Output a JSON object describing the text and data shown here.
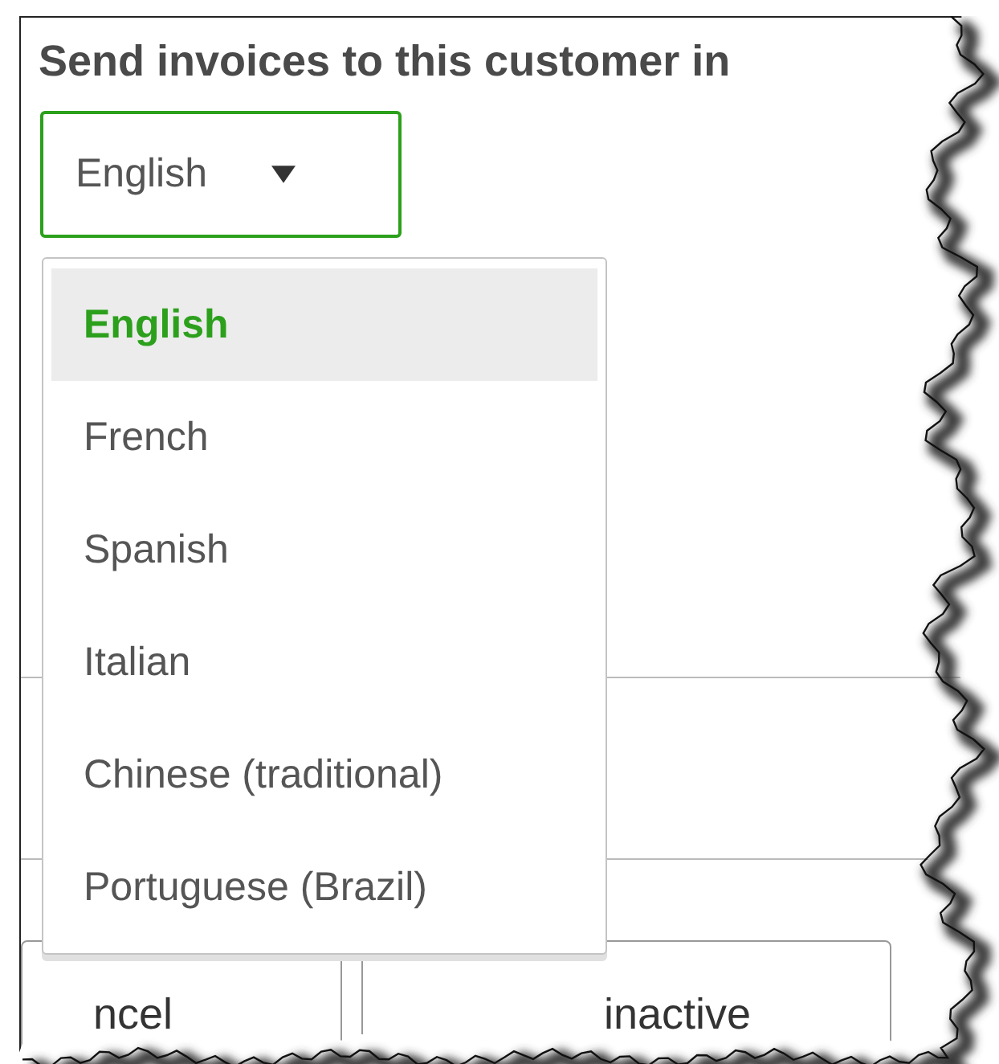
{
  "field": {
    "label": "Send invoices to this customer in",
    "value": "English",
    "focused": true
  },
  "dropdown": {
    "open": true,
    "options": [
      {
        "label": "English",
        "selected": true
      },
      {
        "label": "French",
        "selected": false
      },
      {
        "label": "Spanish",
        "selected": false
      },
      {
        "label": "Italian",
        "selected": false
      },
      {
        "label": "Chinese (traditional)",
        "selected": false
      },
      {
        "label": "Portuguese (Brazil)",
        "selected": false
      }
    ]
  },
  "buttons": [
    {
      "label": "ncel"
    },
    {
      "label": "inactive"
    }
  ]
}
